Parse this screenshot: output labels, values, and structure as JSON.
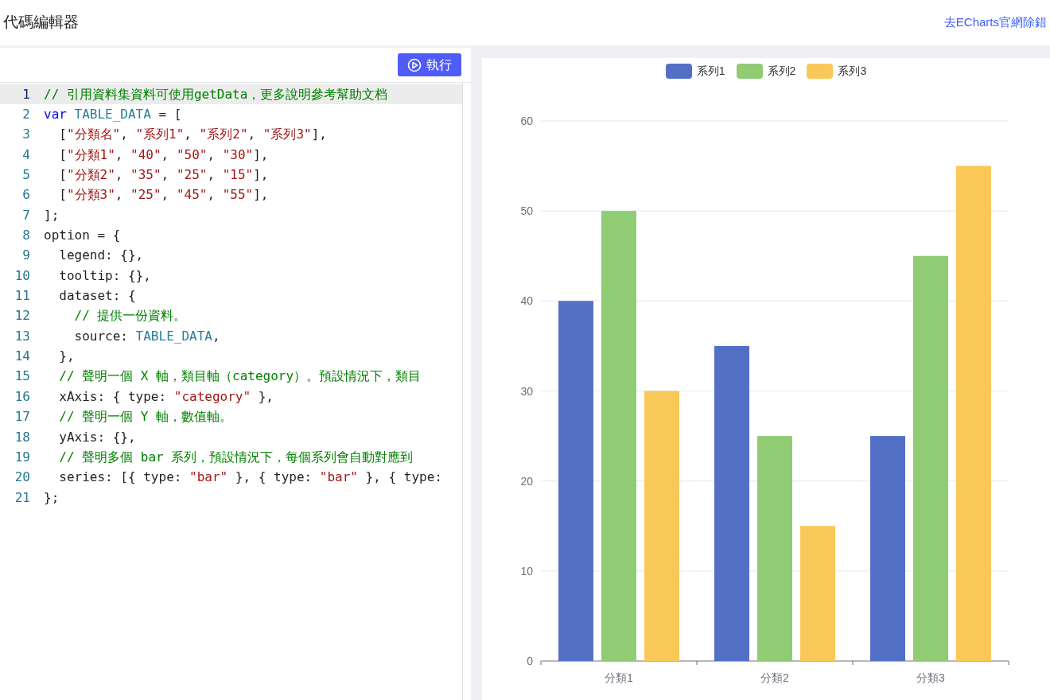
{
  "header": {
    "title": "代碼編輯器",
    "link": "去ECharts官網除錯"
  },
  "toolbar": {
    "run_button": "執行"
  },
  "editor": {
    "lines": [
      {
        "number": "1",
        "current": true,
        "tokens": [
          {
            "text": "// 引用資料集資料可使用getData，更多說明參考幫助文档",
            "kind": "comment"
          }
        ]
      },
      {
        "number": "2",
        "current": false,
        "tokens": [
          {
            "text": "var ",
            "kind": "keyword"
          },
          {
            "text": "TABLE_DATA",
            "kind": "var"
          },
          {
            "text": " = [",
            "kind": "plain"
          }
        ]
      },
      {
        "number": "3",
        "current": false,
        "tokens": [
          {
            "text": "  [",
            "kind": "plain"
          },
          {
            "text": "\"分類名\"",
            "kind": "string"
          },
          {
            "text": ", ",
            "kind": "plain"
          },
          {
            "text": "\"系列1\"",
            "kind": "string"
          },
          {
            "text": ", ",
            "kind": "plain"
          },
          {
            "text": "\"系列2\"",
            "kind": "string"
          },
          {
            "text": ", ",
            "kind": "plain"
          },
          {
            "text": "\"系列3\"",
            "kind": "string"
          },
          {
            "text": "],",
            "kind": "plain"
          }
        ]
      },
      {
        "number": "4",
        "current": false,
        "tokens": [
          {
            "text": "  [",
            "kind": "plain"
          },
          {
            "text": "\"分類1\"",
            "kind": "string"
          },
          {
            "text": ", ",
            "kind": "plain"
          },
          {
            "text": "\"40\"",
            "kind": "string"
          },
          {
            "text": ", ",
            "kind": "plain"
          },
          {
            "text": "\"50\"",
            "kind": "string"
          },
          {
            "text": ", ",
            "kind": "plain"
          },
          {
            "text": "\"30\"",
            "kind": "string"
          },
          {
            "text": "],",
            "kind": "plain"
          }
        ]
      },
      {
        "number": "5",
        "current": false,
        "tokens": [
          {
            "text": "  [",
            "kind": "plain"
          },
          {
            "text": "\"分類2\"",
            "kind": "string"
          },
          {
            "text": ", ",
            "kind": "plain"
          },
          {
            "text": "\"35\"",
            "kind": "string"
          },
          {
            "text": ", ",
            "kind": "plain"
          },
          {
            "text": "\"25\"",
            "kind": "string"
          },
          {
            "text": ", ",
            "kind": "plain"
          },
          {
            "text": "\"15\"",
            "kind": "string"
          },
          {
            "text": "],",
            "kind": "plain"
          }
        ]
      },
      {
        "number": "6",
        "current": false,
        "tokens": [
          {
            "text": "  [",
            "kind": "plain"
          },
          {
            "text": "\"分類3\"",
            "kind": "string"
          },
          {
            "text": ", ",
            "kind": "plain"
          },
          {
            "text": "\"25\"",
            "kind": "string"
          },
          {
            "text": ", ",
            "kind": "plain"
          },
          {
            "text": "\"45\"",
            "kind": "string"
          },
          {
            "text": ", ",
            "kind": "plain"
          },
          {
            "text": "\"55\"",
            "kind": "string"
          },
          {
            "text": "],",
            "kind": "plain"
          }
        ]
      },
      {
        "number": "7",
        "current": false,
        "tokens": [
          {
            "text": "];",
            "kind": "plain"
          }
        ]
      },
      {
        "number": "8",
        "current": false,
        "tokens": [
          {
            "text": "option = {",
            "kind": "plain"
          }
        ]
      },
      {
        "number": "9",
        "current": false,
        "tokens": [
          {
            "text": "  legend: {},",
            "kind": "plain"
          }
        ]
      },
      {
        "number": "10",
        "current": false,
        "tokens": [
          {
            "text": "  tooltip: {},",
            "kind": "plain"
          }
        ]
      },
      {
        "number": "11",
        "current": false,
        "tokens": [
          {
            "text": "  dataset: {",
            "kind": "plain"
          }
        ]
      },
      {
        "number": "12",
        "current": false,
        "tokens": [
          {
            "text": "    // 提供一份資料。",
            "kind": "comment"
          }
        ]
      },
      {
        "number": "13",
        "current": false,
        "tokens": [
          {
            "text": "    source: ",
            "kind": "plain"
          },
          {
            "text": "TABLE_DATA",
            "kind": "var"
          },
          {
            "text": ",",
            "kind": "plain"
          }
        ]
      },
      {
        "number": "14",
        "current": false,
        "tokens": [
          {
            "text": "  },",
            "kind": "plain"
          }
        ]
      },
      {
        "number": "15",
        "current": false,
        "tokens": [
          {
            "text": "  // 聲明一個 X 軸，類目軸（category）。預設情況下，類目",
            "kind": "comment"
          }
        ]
      },
      {
        "number": "16",
        "current": false,
        "tokens": [
          {
            "text": "  xAxis: { type: ",
            "kind": "plain"
          },
          {
            "text": "\"category\"",
            "kind": "string"
          },
          {
            "text": " },",
            "kind": "plain"
          }
        ]
      },
      {
        "number": "17",
        "current": false,
        "tokens": [
          {
            "text": "  // 聲明一個 Y 軸，數值軸。",
            "kind": "comment"
          }
        ]
      },
      {
        "number": "18",
        "current": false,
        "tokens": [
          {
            "text": "  yAxis: {},",
            "kind": "plain"
          }
        ]
      },
      {
        "number": "19",
        "current": false,
        "tokens": [
          {
            "text": "  // 聲明多個 bar 系列，預設情況下，每個系列會自動對應到",
            "kind": "comment"
          }
        ]
      },
      {
        "number": "20",
        "current": false,
        "tokens": [
          {
            "text": "  series: [{ type: ",
            "kind": "plain"
          },
          {
            "text": "\"bar\"",
            "kind": "string"
          },
          {
            "text": " }, { type: ",
            "kind": "plain"
          },
          {
            "text": "\"bar\"",
            "kind": "string"
          },
          {
            "text": " }, { type:",
            "kind": "plain"
          }
        ]
      },
      {
        "number": "21",
        "current": false,
        "tokens": [
          {
            "text": "};",
            "kind": "plain"
          }
        ]
      }
    ]
  },
  "chart": {
    "chart_data": {
      "type": "bar",
      "categories": [
        "分類1",
        "分類2",
        "分類3"
      ],
      "series": [
        {
          "name": "系列1",
          "color": "#5470c6",
          "values": [
            40,
            35,
            25
          ]
        },
        {
          "name": "系列2",
          "color": "#91cc75",
          "values": [
            50,
            25,
            45
          ]
        },
        {
          "name": "系列3",
          "color": "#fac858",
          "values": [
            30,
            15,
            55
          ]
        }
      ],
      "ylim": [
        0,
        60
      ],
      "yticks": [
        {
          "value": 0,
          "label": "0"
        },
        {
          "value": 10,
          "label": "10"
        },
        {
          "value": 20,
          "label": "20"
        },
        {
          "value": 30,
          "label": "30"
        },
        {
          "value": 40,
          "label": "40"
        },
        {
          "value": 50,
          "label": "50"
        },
        {
          "value": 60,
          "label": "60"
        }
      ],
      "grid": true,
      "legend": true
    }
  }
}
